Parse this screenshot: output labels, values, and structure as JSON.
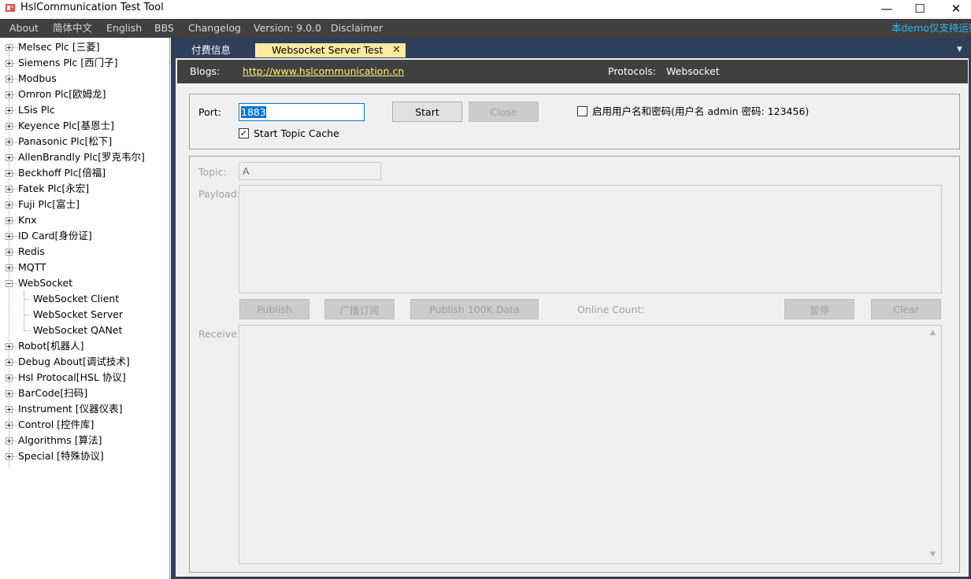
{
  "window": {
    "title": "HslCommunication Test Tool",
    "minimize": "—",
    "maximize": "☐",
    "close": "✕"
  },
  "menu": {
    "about": "About",
    "chinese": "简体中文",
    "english": "English",
    "bbs": "BBS",
    "changelog": "Changelog",
    "version": "Version: 9.0.0",
    "disclaimer": "Disclaimer",
    "notice": "本demo仅支持运行"
  },
  "tree": {
    "melsec": "Melsec Plc [三菱]",
    "siemens": "Siemens Plc [西门子]",
    "modbus": "Modbus",
    "omron": "Omron Plc[欧姆龙]",
    "lsis": "LSis Plc",
    "keyence": "Keyence Plc[基恩士]",
    "panasonic": "Panasonic Plc[松下]",
    "allenbradly": "AllenBrandly Plc[罗克韦尔]",
    "beckhoff": "Beckhoff Plc[倍福]",
    "fatek": "Fatek Plc[永宏]",
    "fuji": "Fuji Plc[富士]",
    "knx": "Knx",
    "idcard": "ID Card[身份证]",
    "redis": "Redis",
    "mqtt": "MQTT",
    "websocket": "WebSocket",
    "ws_client": "WebSocket Client",
    "ws_server": "WebSocket Server",
    "ws_qanet": "WebSocket QANet",
    "robot": "Robot[机器人]",
    "debug": "Debug About[调试技术]",
    "hsl": "Hsl Protocal[HSL 协议]",
    "barcode": "BarCode[扫码]",
    "instrument": "Instrument [仪器仪表]",
    "control": "Control [控件库]",
    "algorithms": "Algorithms [算法]",
    "special": "Special [特殊协议]"
  },
  "tabs": {
    "paid": "付费信息",
    "websocket_server": "Websocket Server Test",
    "close": "✕",
    "dropdown": "▼"
  },
  "info": {
    "blogs_label": "Blogs:",
    "blogs_url": "http://www.hslcommunication.cn",
    "protocols_label": "Protocols:",
    "protocols_value": "Websocket"
  },
  "server": {
    "port_label": "Port:",
    "port_value": "1883",
    "start": "Start",
    "close": "Close",
    "auth_label": "启用用户名和密码(用户名 admin  密码: 123456)",
    "auth_checked": false,
    "topic_cache_label": "Start Topic Cache",
    "topic_cache_checked": true,
    "checkmark": "✓"
  },
  "publish": {
    "topic_label": "Topic:",
    "topic_value": "A",
    "payload_label": "Payload:",
    "publish": "Publish",
    "broadcast": "广播订阅",
    "publish_100k": "Publish 100K Data",
    "online_count": "Online Count:",
    "pause": "暂停",
    "clear": "Clear",
    "receive_label": "Receive:",
    "scroll_up": "▲",
    "scroll_down": "▼"
  }
}
